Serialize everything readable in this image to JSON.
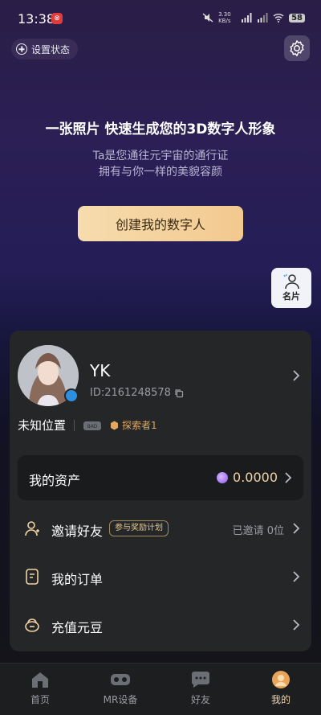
{
  "status_bar": {
    "time": "13:38",
    "notif": "⊗",
    "speed": "3.30 KB/s",
    "battery": "58"
  },
  "header": {
    "set_status_label": "设置状态"
  },
  "hero": {
    "title": "一张照片 快速生成您的3D数字人形象",
    "subtitle_line1": "Ta是您通往元宇宙的通行证",
    "subtitle_line2": "拥有与你一样的美貌容颜",
    "create_button": "创建我的数字人"
  },
  "namecard": {
    "label": "名片"
  },
  "profile": {
    "name": "YK",
    "id": "ID:2161248578",
    "location": "未知位置",
    "device_label": "BAD",
    "explorer_label": "探索者1"
  },
  "assets": {
    "label": "我的资产",
    "value": "0.0000"
  },
  "menu": {
    "invite_label": "邀请好友",
    "invite_badge": "参与奖励计划",
    "invite_status": "已邀请 0位",
    "orders_label": "我的订单",
    "recharge_label": "充值元豆"
  },
  "tabs": [
    {
      "label": "首页",
      "icon": "home-icon"
    },
    {
      "label": "MR设备",
      "icon": "vr-headset-icon"
    },
    {
      "label": "好友",
      "icon": "chat-icon"
    },
    {
      "label": "我的",
      "icon": "profile-icon"
    }
  ],
  "colors": {
    "accent": "#f2d3a4",
    "card": "#242628",
    "button": "#f6dcae"
  }
}
